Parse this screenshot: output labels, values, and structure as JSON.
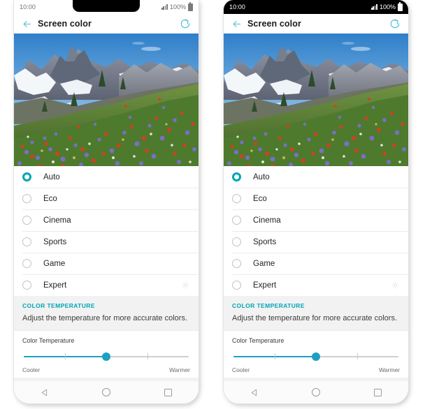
{
  "phones": [
    {
      "id": "left",
      "notch": true,
      "status": {
        "clock": "10:00",
        "battery_pct": "100%",
        "signal_icon": "signal-bars-icon",
        "battery_icon": "battery-icon"
      },
      "appbar": {
        "title": "Screen color",
        "back_icon": "back-arrow-icon",
        "reset_icon": "reset-refresh-icon"
      },
      "hero": {
        "alt": "wildflower-meadow-mountain-photo"
      },
      "options": [
        {
          "label": "Auto",
          "selected": true,
          "gear": false
        },
        {
          "label": "Eco",
          "selected": false,
          "gear": false
        },
        {
          "label": "Cinema",
          "selected": false,
          "gear": false
        },
        {
          "label": "Sports",
          "selected": false,
          "gear": false
        },
        {
          "label": "Game",
          "selected": false,
          "gear": false
        },
        {
          "label": "Expert",
          "selected": false,
          "gear": true
        }
      ],
      "section": {
        "title": "COLOR TEMPERATURE",
        "description": "Adjust the temperature for more accurate colors."
      },
      "slider": {
        "label": "Color Temperature",
        "value_pct": 50,
        "ticks_pct": [
          25,
          75
        ],
        "min_label": "Cooler",
        "max_label": "Warmer"
      },
      "nav": {
        "back": "nav-back-icon",
        "home": "nav-home-icon",
        "recents": "nav-recents-icon"
      }
    },
    {
      "id": "right",
      "notch": false,
      "status": {
        "clock": "10:00",
        "battery_pct": "100%",
        "signal_icon": "signal-bars-icon",
        "battery_icon": "battery-icon"
      },
      "appbar": {
        "title": "Screen color",
        "back_icon": "back-arrow-icon",
        "reset_icon": "reset-refresh-icon"
      },
      "hero": {
        "alt": "wildflower-meadow-mountain-photo"
      },
      "options": [
        {
          "label": "Auto",
          "selected": true,
          "gear": false
        },
        {
          "label": "Eco",
          "selected": false,
          "gear": false
        },
        {
          "label": "Cinema",
          "selected": false,
          "gear": false
        },
        {
          "label": "Sports",
          "selected": false,
          "gear": false
        },
        {
          "label": "Game",
          "selected": false,
          "gear": false
        },
        {
          "label": "Expert",
          "selected": false,
          "gear": true
        }
      ],
      "section": {
        "title": "COLOR TEMPERATURE",
        "description": "Adjust the temperature for more accurate colors."
      },
      "slider": {
        "label": "Color Temperature",
        "value_pct": 50,
        "ticks_pct": [
          25,
          75
        ],
        "min_label": "Cooler",
        "max_label": "Warmer"
      },
      "nav": {
        "back": "nav-back-icon",
        "home": "nav-home-icon",
        "recents": "nav-recents-icon"
      }
    }
  ],
  "colors": {
    "accent_teal": "#00a5b5",
    "slider_blue": "#1e9fc4",
    "back_arrow": "#6fc5d8",
    "section_bg": "#f2f2f2",
    "divider": "#ececec",
    "text_primary": "#242424",
    "nav_icon": "#9b9b9b"
  }
}
